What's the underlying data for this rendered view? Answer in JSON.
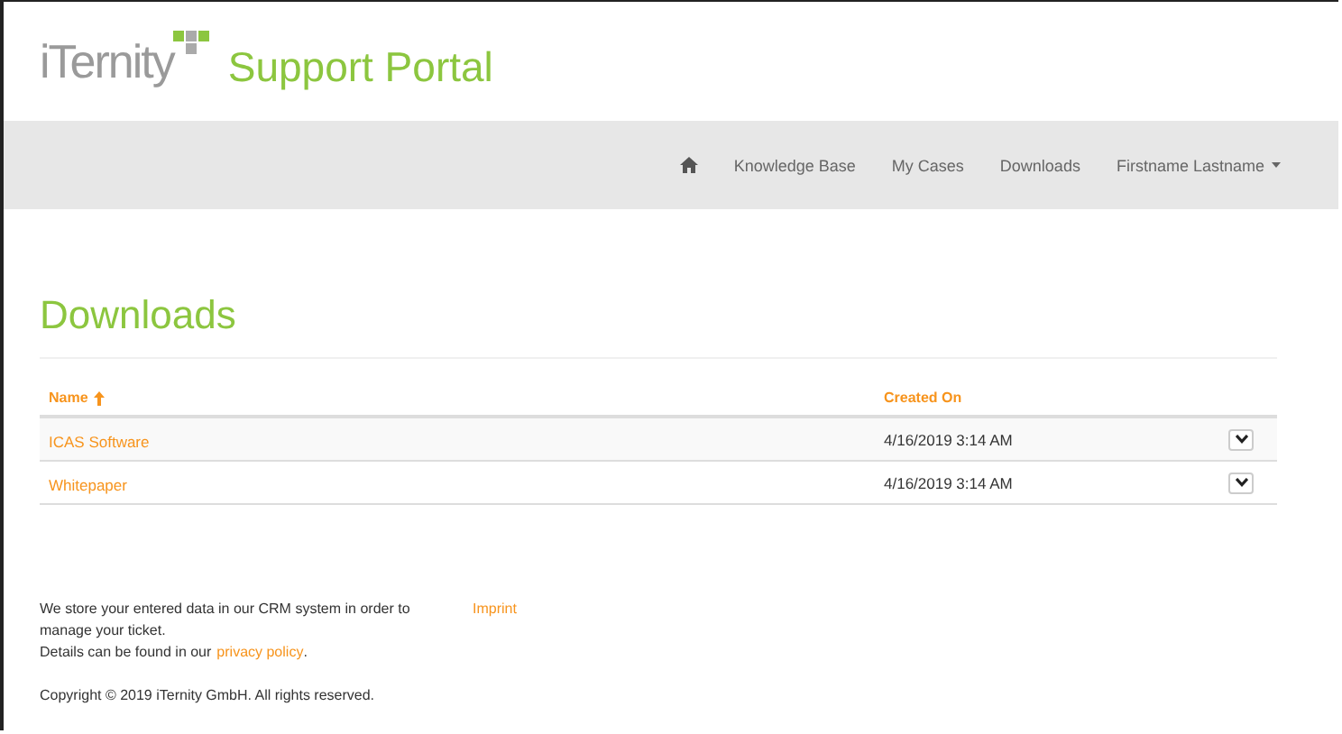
{
  "header": {
    "logo": "iTernity",
    "title": "Support Portal"
  },
  "nav": {
    "items": [
      {
        "kind": "home"
      },
      {
        "kind": "link",
        "label": "Knowledge Base"
      },
      {
        "kind": "link",
        "label": "My Cases"
      },
      {
        "kind": "link",
        "label": "Downloads"
      },
      {
        "kind": "dropdown",
        "label": "Firstname Lastname"
      }
    ]
  },
  "page_title": "Downloads",
  "table": {
    "columns": [
      {
        "label": "Name",
        "sorted": true
      },
      {
        "label": "Created On",
        "sorted": false
      }
    ],
    "rows": [
      {
        "name": "ICAS Software",
        "created_on": "4/16/2019 3:14 AM"
      },
      {
        "name": "Whitepaper",
        "created_on": "4/16/2019 3:14 AM"
      }
    ]
  },
  "footer": {
    "notice": "We store your entered data in our CRM system in order to manage your ticket.",
    "details_prefix": "Details can be found in our",
    "privacy_link": "privacy policy",
    "details_suffix": ".",
    "imprint": "Imprint",
    "copyright": "Copyright © 2019 iTernity GmbH. All rights reserved."
  }
}
